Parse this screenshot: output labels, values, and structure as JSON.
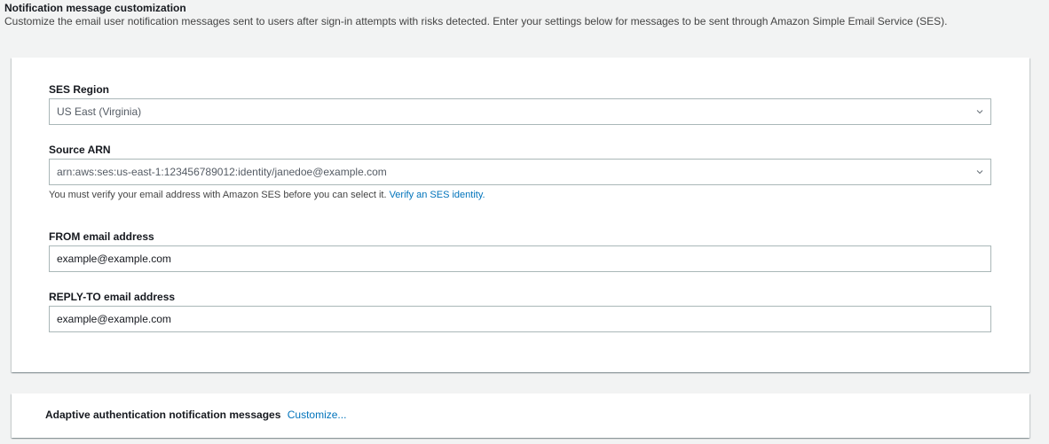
{
  "header": {
    "title": "Notification message customization",
    "description": "Customize the email user notification messages sent to users after sign-in attempts with risks detected. Enter your settings below for messages to be sent through Amazon Simple Email Service (SES)."
  },
  "form": {
    "ses_region": {
      "label": "SES Region",
      "value": "US East (Virginia)"
    },
    "source_arn": {
      "label": "Source ARN",
      "value": "arn:aws:ses:us-east-1:123456789012:identity/janedoe@example.com",
      "helper_text": "You must verify your email address with Amazon SES before you can select it. ",
      "helper_link": "Verify an SES identity."
    },
    "from_email": {
      "label": "FROM email address",
      "value": "example@example.com"
    },
    "reply_to_email": {
      "label": "REPLY-TO email address",
      "value": "example@example.com"
    }
  },
  "adaptive": {
    "label": "Adaptive authentication notification messages",
    "link": "Customize..."
  },
  "icons": {
    "select_chevron": "chevron-down-icon"
  },
  "colors": {
    "link": "#0073bb",
    "background": "#f2f3f3",
    "border": "#aab7b8"
  }
}
